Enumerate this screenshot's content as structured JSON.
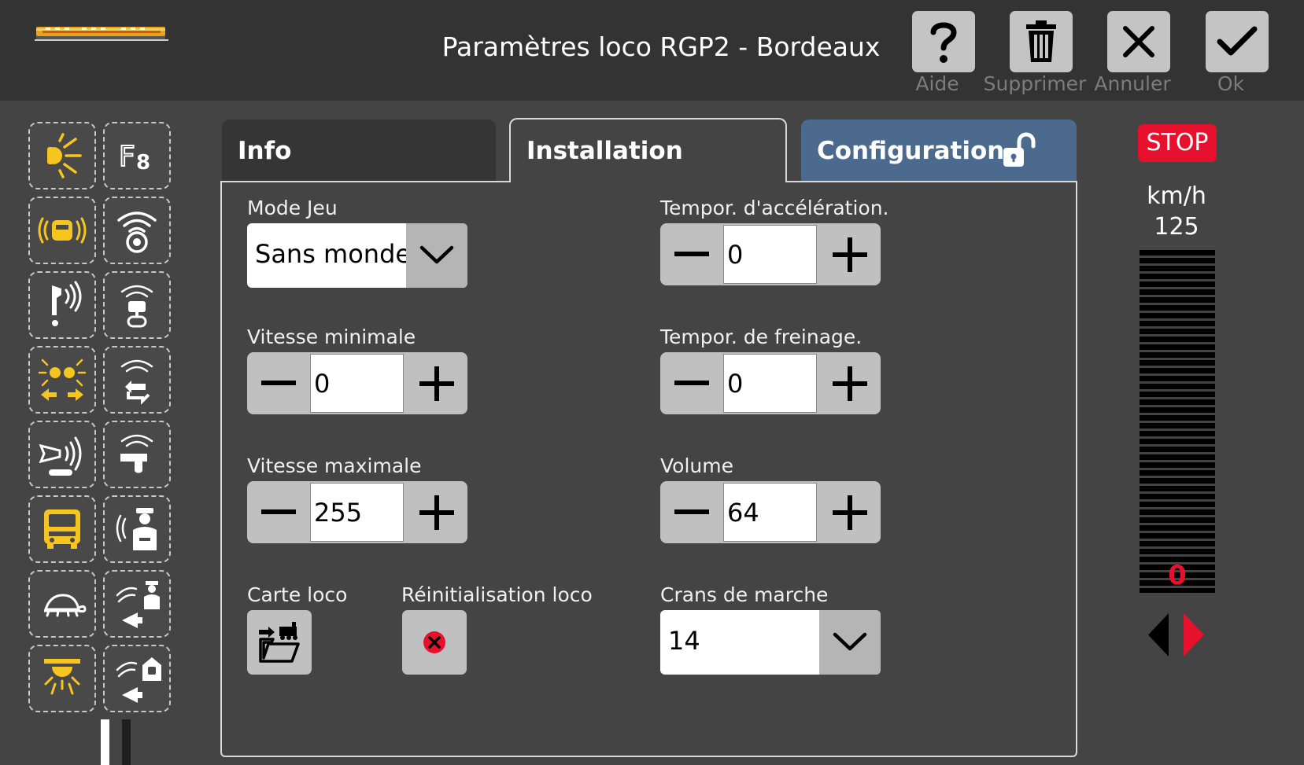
{
  "header": {
    "title": "Paramètres loco RGP2 - Bordeaux",
    "buttons": {
      "help": "Aide",
      "delete": "Supprimer",
      "cancel": "Annuler",
      "ok": "Ok"
    }
  },
  "function_buttons": [
    {
      "icon": "headlight-icon",
      "active": true
    },
    {
      "icon": "f8-icon",
      "active": false
    },
    {
      "icon": "sound-loco-icon",
      "active": true
    },
    {
      "icon": "sound-speaker-icon",
      "active": false
    },
    {
      "icon": "horn-signal-icon",
      "active": false
    },
    {
      "icon": "sound-driver-icon",
      "active": false
    },
    {
      "icon": "light-direction-icon",
      "active": true
    },
    {
      "icon": "sound-switch-icon",
      "active": false
    },
    {
      "icon": "horn-icon",
      "active": false
    },
    {
      "icon": "sound-whistle-icon",
      "active": false
    },
    {
      "icon": "cabin-front-icon",
      "active": true
    },
    {
      "icon": "conductor-icon",
      "active": false
    },
    {
      "icon": "turtle-shunting-icon",
      "active": false
    },
    {
      "icon": "conductor-announce-icon",
      "active": false
    },
    {
      "icon": "cabin-light-icon",
      "active": true
    },
    {
      "icon": "station-announce-icon",
      "active": false
    }
  ],
  "tabs": {
    "info": "Info",
    "installation": "Installation",
    "configuration": "Configuration"
  },
  "fields": {
    "mode_jeu": {
      "label": "Mode Jeu",
      "value": "Sans monde"
    },
    "vitesse_min": {
      "label": "Vitesse minimale",
      "value": "0"
    },
    "vitesse_max": {
      "label": "Vitesse maximale",
      "value": "255"
    },
    "carte_loco": {
      "label": "Carte loco"
    },
    "reinit_loco": {
      "label": "Réinitialisation loco"
    },
    "tempo_accel": {
      "label": "Tempor. d'accélération.",
      "value": "0"
    },
    "tempo_frein": {
      "label": "Tempor. de freinage.",
      "value": "0"
    },
    "volume": {
      "label": "Volume",
      "value": "64"
    },
    "crans": {
      "label": "Crans de marche",
      "value": "14"
    }
  },
  "speed": {
    "stop_label": "STOP",
    "unit": "km/h",
    "max": "125",
    "current": "0",
    "direction": "forward"
  },
  "colors": {
    "accent_yellow": "#f7c520",
    "config_tab": "#4c6a8e",
    "stop_red": "#e8112d"
  }
}
